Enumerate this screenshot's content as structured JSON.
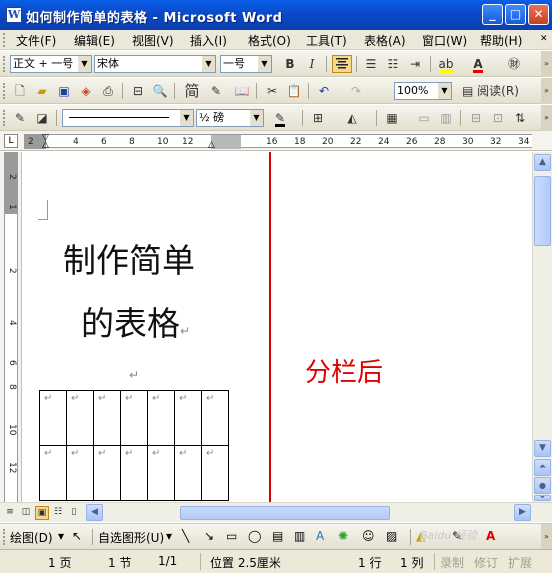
{
  "window": {
    "title": "如何制作简单的表格 - Microsoft Word",
    "icon_letter": "W"
  },
  "menu": [
    "文件(F)",
    "编辑(E)",
    "视图(V)",
    "插入(I)",
    "格式(O)",
    "工具(T)",
    "表格(A)",
    "窗口(W)",
    "帮助(H)"
  ],
  "format_toolbar": {
    "style": "正文 + 一号",
    "font": "宋体",
    "size": "一号",
    "bold": "B",
    "italic": "I"
  },
  "standard_toolbar": {
    "chinese_convert": "简",
    "zoom": "100%",
    "read_label": "阅读(R)"
  },
  "table_toolbar": {
    "line_weight": "½ 磅"
  },
  "ruler": {
    "h_numbers": [
      "2",
      "2",
      "4",
      "6",
      "8",
      "10",
      "12",
      "14",
      "16",
      "18",
      "20",
      "22",
      "24",
      "26",
      "28",
      "30",
      "32",
      "34"
    ],
    "v_numbers": [
      "2",
      "1",
      "2",
      "4",
      "6",
      "8",
      "10",
      "12"
    ]
  },
  "document": {
    "title_line1": "制作简单",
    "title_line2": "的表格",
    "para_mark": "↵",
    "column_text": "分栏后",
    "table_rows": 2,
    "table_cols": 7
  },
  "drawing_toolbar": {
    "draw_label": "绘图(D)",
    "autoshapes_label": "自选图形(U)"
  },
  "status": {
    "page": "1 页",
    "section": "1 节",
    "pages": "1/1",
    "position": "位置 2.5厘米",
    "line": "1 行",
    "column": "1 列",
    "rec": "录制",
    "trk": "修订",
    "ext": "扩展"
  },
  "colors": {
    "title_bar": "#0b49c8",
    "column_line": "#d40000",
    "column_text": "#e00000"
  }
}
